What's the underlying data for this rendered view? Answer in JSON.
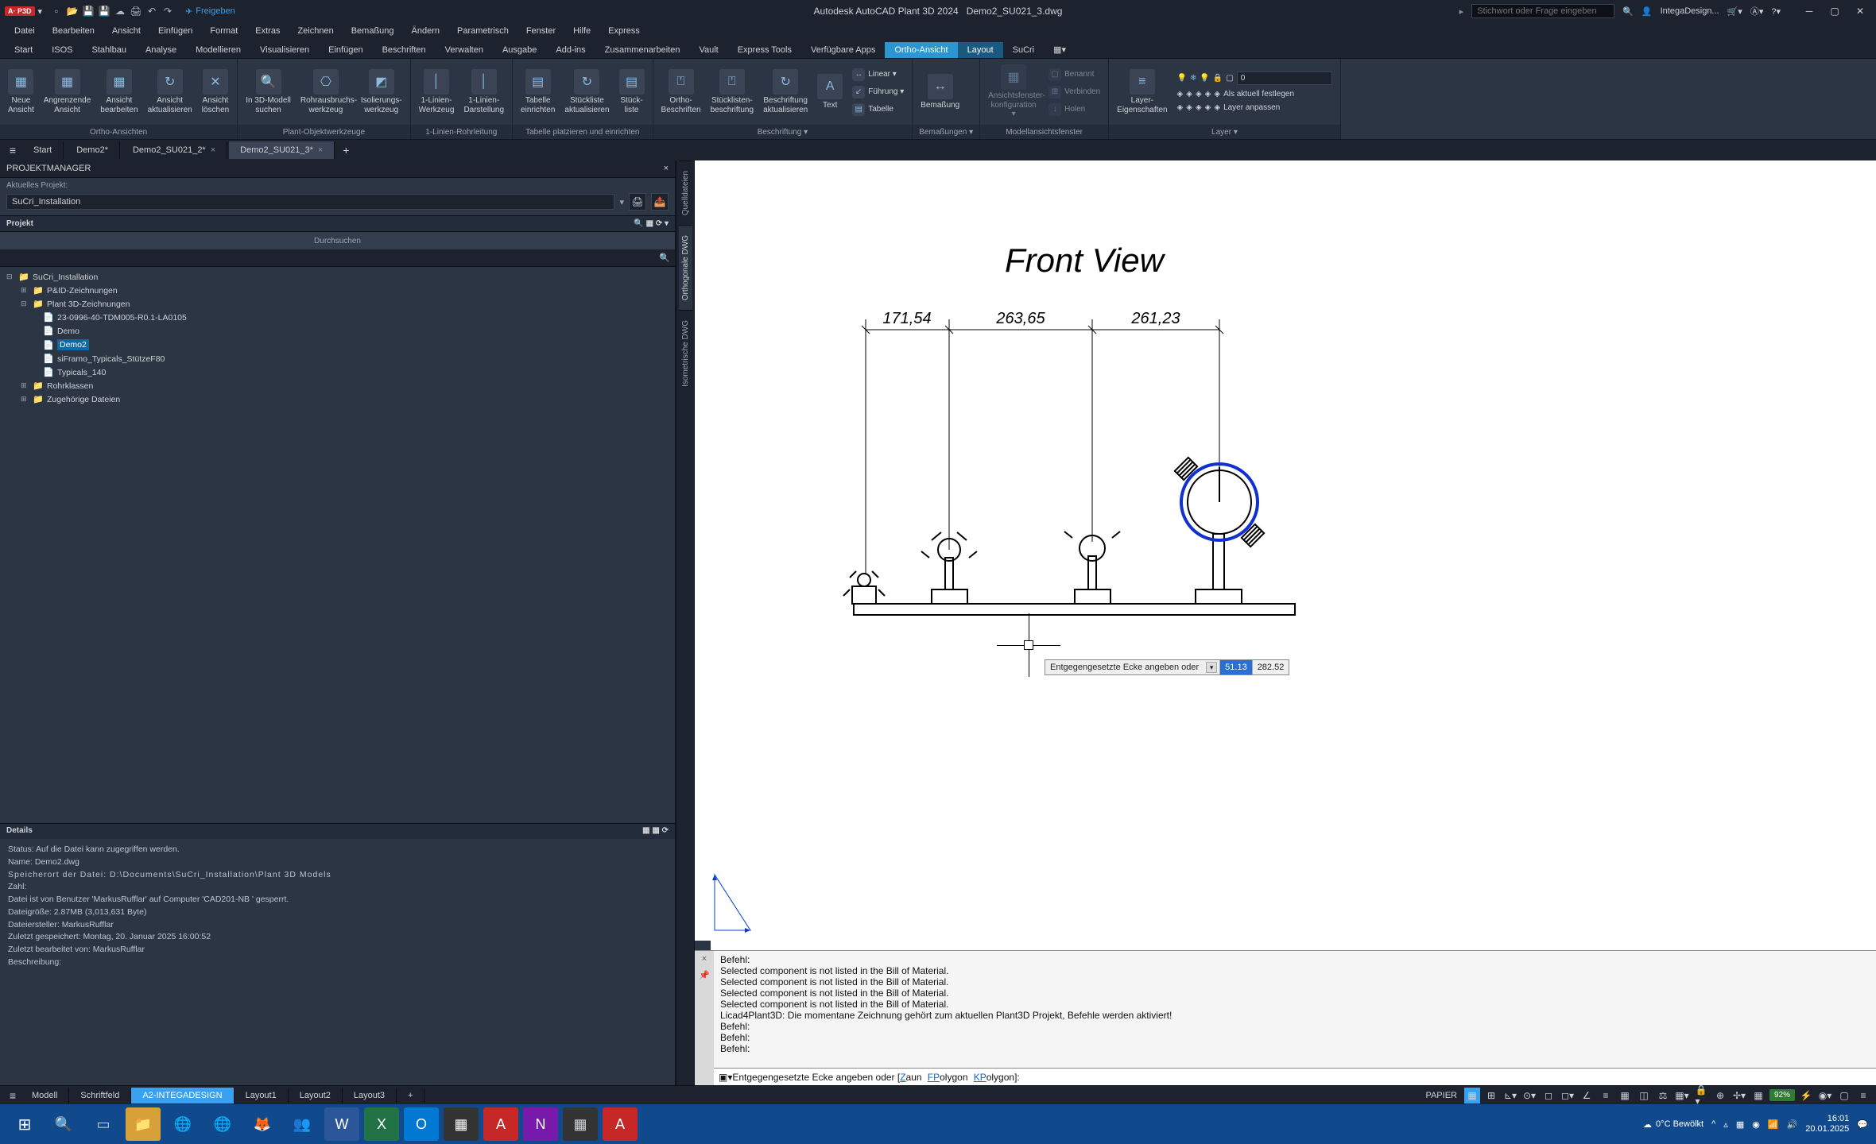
{
  "app": {
    "badge": "A· P3D",
    "title_prefix": "Autodesk AutoCAD Plant 3D 2024",
    "doc_name": "Demo2_SU021_3.dwg",
    "share": "Freigeben",
    "search_placeholder": "Stichwort oder Frage eingeben",
    "user": "IntegaDesign..."
  },
  "menubar": [
    "Datei",
    "Bearbeiten",
    "Ansicht",
    "Einfügen",
    "Format",
    "Extras",
    "Zeichnen",
    "Bemaßung",
    "Ändern",
    "Parametrisch",
    "Fenster",
    "Hilfe",
    "Express"
  ],
  "ribbon_tabs": [
    "Start",
    "ISOS",
    "Stahlbau",
    "Analyse",
    "Modellieren",
    "Visualisieren",
    "Einfügen",
    "Beschriften",
    "Verwalten",
    "Ausgabe",
    "Add-ins",
    "Zusammenarbeiten",
    "Vault",
    "Express Tools",
    "Verfügbare Apps",
    "Ortho-Ansicht",
    "Layout",
    "SuCri"
  ],
  "ribbon_active": "Ortho-Ansicht",
  "ribbon": {
    "panel1": {
      "title": "Ortho-Ansichten",
      "btn1": "Neue\nAnsicht",
      "btn2": "Angrenzende\nAnsicht",
      "btn3": "Ansicht\nbearbeiten",
      "btn4": "Ansicht\naktualisieren",
      "btn5": "Ansicht\nlöschen"
    },
    "panel2": {
      "title": "Plant-Objektwerkzeuge",
      "btn1": "In 3D-Modell\nsuchen",
      "btn2": "Rohrausbruchs-\nwerkzeug",
      "btn3": "Isolierungs-\nwerkzeug"
    },
    "panel3": {
      "title": "1-Linien-Rohrleitung",
      "btn1": "1-Linien-\nWerkzeug",
      "btn2": "1-Linien-\nDarstellung"
    },
    "panel4": {
      "title": "Tabelle platzieren und einrichten",
      "btn1": "Tabelle\neinrichten",
      "btn2": "Stückliste\naktualisieren",
      "btn3": "Stück-\nliste"
    },
    "panel5": {
      "title": "Beschriftung ▾",
      "btn1": "Ortho-\nBeschriften",
      "btn2": "Stücklisten-\nbeschriftung",
      "btn3": "Beschriftung\naktualisieren",
      "btn4": "Text",
      "r1": "Linear ▾",
      "r2": "Führung ▾",
      "r3": "Tabelle"
    },
    "panel6": {
      "title": "Bemaßungen ▾",
      "btn1": "Bemaßung"
    },
    "panel7": {
      "title": "Modellansichtsfenster",
      "btn1": "Ansichtsfenster-\nkonfiguration ▾",
      "r1": "Benannt",
      "r2": "Verbinden",
      "r3": "Holen"
    },
    "panel8": {
      "title": "Layer ▾",
      "btn1": "Layer-\nEigenschaften",
      "sel": "0",
      "r1": "Als aktuell festlegen",
      "r2": "Layer anpassen"
    }
  },
  "doc_tabs": {
    "start": "Start",
    "t1": "Demo2*",
    "t2": "Demo2_SU021_2*",
    "t3": "Demo2_SU021_3*"
  },
  "pm": {
    "title": "PROJEKTMANAGER",
    "sub": "Aktuelles Projekt:",
    "proj": "SuCri_Installation",
    "section": "Projekt",
    "search": "Durchsuchen",
    "tree": {
      "root": "SuCri_Installation",
      "pid": "P&ID-Zeichnungen",
      "p3d": "Plant 3D-Zeichnungen",
      "f1": "23-0996-40-TDM005-R0.1-LA0105",
      "f2": "Demo",
      "f3": "Demo2",
      "f4": "siFramo_Typicals_StützeF80",
      "f5": "Typicals_140",
      "rohr": "Rohrklassen",
      "zug": "Zugehörige Dateien"
    }
  },
  "details": {
    "title": "Details",
    "status": "Status: Auf die Datei kann zugegriffen werden.",
    "name": "Name: Demo2.dwg",
    "ort": "Speicherort der Datei: D:\\Documents\\SuCri_Installation\\Plant 3D Models",
    "zahl": "Zahl:",
    "lock": "Datei ist von Benutzer 'MarkusRufflar' auf Computer 'CAD201-NB ' gesperrt.",
    "size": "Dateigröße: 2.87MB (3,013,631 Byte)",
    "creator": "Dateiersteller: MarkusRufflar",
    "saved": "Zuletzt gespeichert: Montag, 20. Januar 2025 16:00:52",
    "edited": "Zuletzt bearbeitet von: MarkusRufflar",
    "desc": "Beschreibung:"
  },
  "side_tabs": [
    "Quelldateien",
    "Orthogonale DWG",
    "Isometrische DWG"
  ],
  "drawing": {
    "title": "Front View",
    "dim1": "171,54",
    "dim2": "263,65",
    "dim3": "261,23",
    "dyn_prompt": "Entgegengesetzte Ecke angeben oder",
    "dyn_val1": "51.13",
    "dyn_val2": "282.52"
  },
  "cmd": {
    "lines": [
      "Befehl:",
      "Selected component is not listed in the Bill of Material.",
      "Selected component is not listed in the Bill of Material.",
      "Selected component is not listed in the Bill of Material.",
      "Selected component is not listed in the Bill of Material.",
      "Licad4Plant3D: Die momentane Zeichnung gehört zum aktuellen Plant3D Projekt, Befehle werden aktiviert!",
      "Befehl:",
      "Befehl:",
      "Befehl:"
    ],
    "prompt_pre": "Entgegengesetzte Ecke angeben oder [",
    "opt1_l": "Z",
    "opt1_r": "aun",
    "opt2_l": "FP",
    "opt2_r": "olygon",
    "opt3_l": "KP",
    "opt3_r": "olygon",
    "prompt_post": "]:"
  },
  "layout_tabs": [
    "Modell",
    "Schriftfeld",
    "A2-INTEGADESIGN",
    "Layout1",
    "Layout2",
    "Layout3"
  ],
  "layout_active": "A2-INTEGADESIGN",
  "status": {
    "paper": "PAPIER",
    "scale": "92%"
  },
  "taskbar": {
    "weather_temp": "0°C",
    "weather_desc": "Bewölkt",
    "time": "16:01",
    "date": "20.01.2025"
  }
}
